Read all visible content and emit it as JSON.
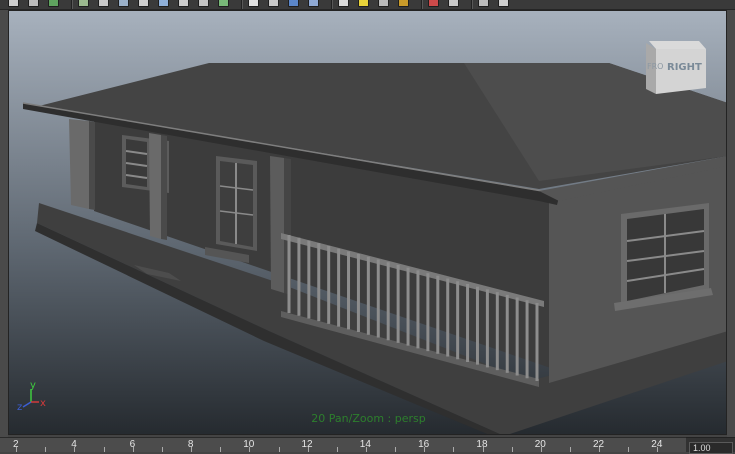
{
  "toolbar": {
    "icons": [
      {
        "name": "select-tool-icon",
        "color": "#cfcfcf"
      },
      {
        "name": "lasso-tool-icon",
        "color": "#bdbdbd"
      },
      {
        "name": "render-view-icon",
        "color": "#5fa35f"
      },
      {
        "name": "paint-tool-icon",
        "color": "#9bb98f"
      },
      {
        "name": "move-tool-icon",
        "color": "#c8c8c8"
      },
      {
        "name": "camera-attributes-icon",
        "color": "#9ab0c8"
      },
      {
        "name": "film-gate-icon",
        "color": "#d0d0d0"
      },
      {
        "name": "grid-icon",
        "color": "#8fb0d9"
      },
      {
        "name": "snapshot-icon",
        "color": "#cccccc"
      },
      {
        "name": "wireframe-icon",
        "color": "#c4c4c4"
      },
      {
        "name": "smooth-shade-icon",
        "color": "#78b878"
      },
      {
        "name": "isolate-select-icon",
        "color": "#e2e2e2"
      },
      {
        "name": "cube-icon",
        "color": "#c8c8c8"
      },
      {
        "name": "shaded-cube-icon",
        "color": "#5b86c8"
      },
      {
        "name": "textured-icon",
        "color": "#8fa9d4"
      },
      {
        "name": "soccer-ball-icon",
        "color": "#dadada"
      },
      {
        "name": "default-light-icon",
        "color": "#e8d23a"
      },
      {
        "name": "all-lights-icon",
        "color": "#b9b9b9"
      },
      {
        "name": "shadows-icon",
        "color": "#c89a2a"
      },
      {
        "name": "xray-icon",
        "color": "#cc4a4a"
      },
      {
        "name": "xray-joints-icon",
        "color": "#c8c8c8"
      },
      {
        "name": "panel-layout-icon",
        "color": "#bdbdbd"
      },
      {
        "name": "hypergraph-icon",
        "color": "#d0d0d0"
      }
    ]
  },
  "viewport": {
    "hud_label": "20 Pan/Zoom : persp",
    "view_cube_label": "RIGHT",
    "view_cube_face": "FRO",
    "axis": {
      "x": "x",
      "y": "y",
      "z": "z"
    },
    "colors": {
      "bg_top": "#a7b1bd",
      "bg_bottom": "#252a2f",
      "model": "#464646",
      "hud": "#2d7f2d"
    }
  },
  "timeslider": {
    "labels": [
      "2",
      "4",
      "6",
      "8",
      "10",
      "12",
      "14",
      "16",
      "18",
      "20",
      "22",
      "24"
    ],
    "current_frame": "1.00"
  }
}
